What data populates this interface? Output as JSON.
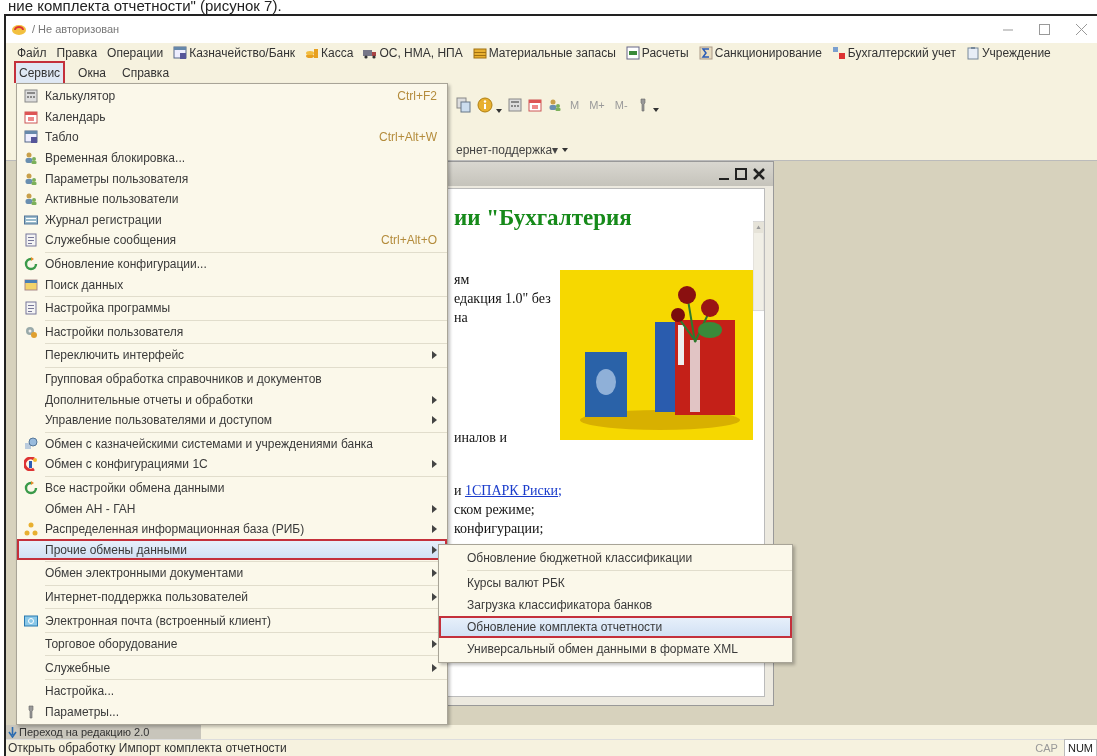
{
  "document_caption": "ние комплекта отчетности\" (рисунок 7).",
  "window": {
    "title": "/ Не авторизован"
  },
  "menubar": [
    {
      "label": "Файл",
      "icon": false
    },
    {
      "label": "Правка",
      "icon": false
    },
    {
      "label": "Операции",
      "icon": false
    },
    {
      "label": "Казначейство/Банк",
      "icon": true
    },
    {
      "label": "Касса",
      "icon": true
    },
    {
      "label": "ОС, НМА, НПА",
      "icon": true
    },
    {
      "label": "Материальные запасы",
      "icon": true
    },
    {
      "label": "Расчеты",
      "icon": true
    },
    {
      "label": "Санкционирование",
      "icon": true
    },
    {
      "label": "Бухгалтерский учет",
      "icon": true
    },
    {
      "label": "Учреждение",
      "icon": true
    }
  ],
  "menubar_2": [
    {
      "label": "Сервис",
      "selected": true
    },
    {
      "label": "Окна",
      "selected": false
    },
    {
      "label": "Справка",
      "selected": false
    }
  ],
  "toolbar": {
    "memory_buttons": [
      "M",
      "M+",
      "M-"
    ],
    "link_fragment": "ернет-поддержка▾"
  },
  "document_window": {
    "heading_fragment": "ии \"Бухгалтерия",
    "lines": [
      "ям",
      "едакция 1.0\" без",
      "на"
    ],
    "line_after_picture": "иналов и",
    "link_prefix": "и",
    "link": "1СПАРК Риски;",
    "tail_lines": [
      "ском режиме;",
      "конфигурации;"
    ]
  },
  "service_menu": [
    {
      "label": "Калькулятор",
      "icon": true,
      "shortcut": "Ctrl+F2",
      "submenu": false,
      "separator_after": false,
      "selected": false
    },
    {
      "label": "Календарь",
      "icon": true,
      "submenu": false,
      "separator_after": false,
      "selected": false
    },
    {
      "label": "Табло",
      "icon": true,
      "shortcut": "Ctrl+Alt+W",
      "submenu": false,
      "separator_after": false,
      "selected": false
    },
    {
      "label": "Временная блокировка...",
      "icon": true,
      "submenu": false,
      "separator_after": false,
      "selected": false
    },
    {
      "label": "Параметры пользователя",
      "icon": true,
      "submenu": false,
      "separator_after": false,
      "selected": false
    },
    {
      "label": "Активные пользователи",
      "icon": true,
      "submenu": false,
      "separator_after": false,
      "selected": false
    },
    {
      "label": "Журнал регистрации",
      "icon": true,
      "submenu": false,
      "separator_after": false,
      "selected": false
    },
    {
      "label": "Служебные сообщения",
      "icon": true,
      "shortcut": "Ctrl+Alt+O",
      "submenu": false,
      "separator_after": true,
      "selected": false
    },
    {
      "label": "Обновление конфигурации...",
      "icon": true,
      "submenu": false,
      "separator_after": false,
      "selected": false
    },
    {
      "label": "Поиск данных",
      "icon": true,
      "submenu": false,
      "separator_after": true,
      "selected": false
    },
    {
      "label": "Настройка программы",
      "icon": true,
      "submenu": false,
      "separator_after": true,
      "selected": false
    },
    {
      "label": "Настройки пользователя",
      "icon": true,
      "submenu": false,
      "separator_after": true,
      "selected": false
    },
    {
      "label": "Переключить интерфейс",
      "icon": false,
      "submenu": true,
      "separator_after": true,
      "selected": false
    },
    {
      "label": "Групповая обработка справочников и документов",
      "icon": false,
      "submenu": false,
      "separator_after": false,
      "selected": false
    },
    {
      "label": "Дополнительные отчеты и обработки",
      "icon": false,
      "submenu": true,
      "separator_after": false,
      "selected": false
    },
    {
      "label": "Управление пользователями и доступом",
      "icon": false,
      "submenu": true,
      "separator_after": true,
      "selected": false
    },
    {
      "label": "Обмен с казначейскими системами и учреждениями банка",
      "icon": true,
      "submenu": false,
      "separator_after": false,
      "selected": false
    },
    {
      "label": "Обмен с конфигурациями 1С",
      "icon": true,
      "submenu": true,
      "separator_after": true,
      "selected": false
    },
    {
      "label": "Все настройки обмена данными",
      "icon": true,
      "submenu": false,
      "separator_after": false,
      "selected": false
    },
    {
      "label": "Обмен АН - ГАН",
      "icon": false,
      "submenu": true,
      "separator_after": false,
      "selected": false
    },
    {
      "label": "Распределенная информационная база (РИБ)",
      "icon": true,
      "submenu": true,
      "separator_after": false,
      "selected": false
    },
    {
      "label": "Прочие обмены данными",
      "icon": false,
      "submenu": true,
      "separator_after": true,
      "selected": true
    },
    {
      "label": "Обмен электронными документами",
      "icon": false,
      "submenu": true,
      "separator_after": true,
      "selected": false
    },
    {
      "label": "Интернет-поддержка пользователей",
      "icon": false,
      "submenu": true,
      "separator_after": true,
      "selected": false
    },
    {
      "label": "Электронная почта (встроенный клиент)",
      "icon": true,
      "submenu": false,
      "separator_after": true,
      "selected": false
    },
    {
      "label": "Торговое оборудование",
      "icon": false,
      "submenu": true,
      "separator_after": true,
      "selected": false
    },
    {
      "label": "Служебные",
      "icon": false,
      "submenu": true,
      "separator_after": true,
      "selected": false
    },
    {
      "label": "Настройка...",
      "icon": false,
      "submenu": false,
      "separator_after": false,
      "selected": false
    },
    {
      "label": "Параметры...",
      "icon": true,
      "submenu": false,
      "separator_after": false,
      "selected": false
    }
  ],
  "submenu": [
    {
      "label": "Обновление бюджетной классификации",
      "separator_after": true,
      "selected": false
    },
    {
      "label": "Курсы валют РБК",
      "separator_after": false,
      "selected": false
    },
    {
      "label": "Загрузка классификатора банков",
      "separator_after": false,
      "selected": false
    },
    {
      "label": "Обновление комплекта отчетности",
      "separator_after": false,
      "selected": true
    },
    {
      "label": "Универсальный обмен данными в формате XML",
      "separator_after": false,
      "selected": false
    }
  ],
  "bottom_panel": {
    "label": "Переход на редакцию 2.0"
  },
  "status_bar": {
    "text": "Открыть обработку Импорт комплекта отчетности",
    "indicators": [
      {
        "label": "CAP",
        "on": false
      },
      {
        "label": "NUM",
        "on": true
      }
    ]
  }
}
